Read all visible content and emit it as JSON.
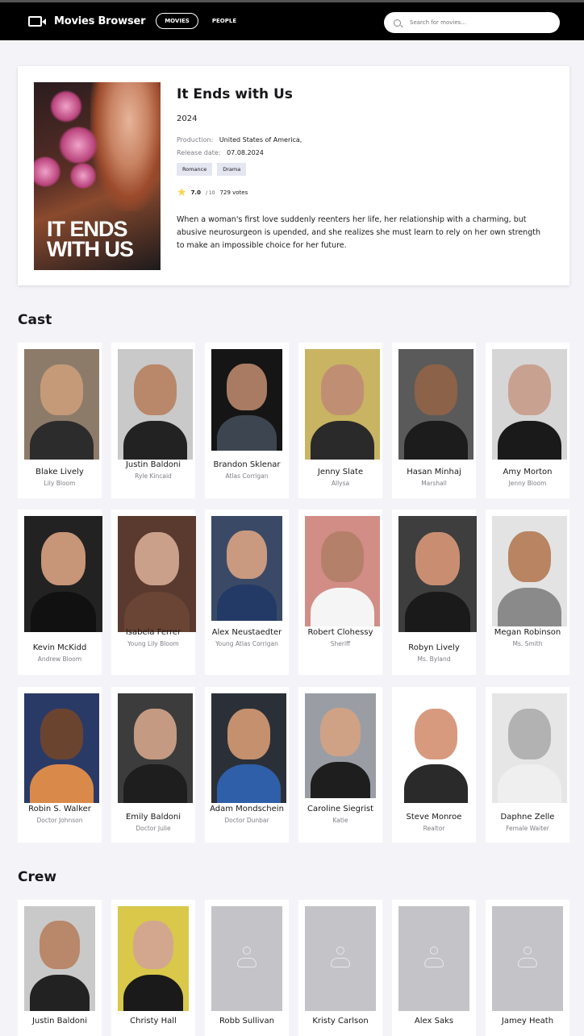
{
  "app": {
    "title": "Movies Browser"
  },
  "nav": {
    "movies_label": "MOVIES",
    "people_label": "PEOPLE"
  },
  "search": {
    "placeholder": "Search for movies..."
  },
  "movie": {
    "poster_text_line1": "IT ENDS",
    "poster_text_line2": "WITH US",
    "title": "It Ends with Us",
    "year": "2024",
    "production_label": "Production:",
    "production": "United States of America,",
    "release_label": "Release date:",
    "release_date": "07.08.2024",
    "genres": [
      "Romance",
      "Drama"
    ],
    "rating": "7.0",
    "rating_max": "/ 10",
    "votes": "729 votes",
    "description": "When a woman's first love suddenly reenters her life, her relationship with a charming, but abusive neurosurgeon is upended, and she realizes she must learn to rely on her own strength to make an impossible choice for her future."
  },
  "cast_title": "Cast",
  "cast": [
    {
      "name": "Blake Lively",
      "role": "Lily Bloom",
      "colors": [
        "#8d7b6a",
        "#c49a78",
        "#2c2c2c"
      ]
    },
    {
      "name": "Justin Baldoni",
      "role": "Ryle Kincaid",
      "colors": [
        "#c9c9c9",
        "#b9876a",
        "#222"
      ]
    },
    {
      "name": "Brandon Sklenar",
      "role": "Atlas Corrigan",
      "colors": [
        "#151515",
        "#a87b62",
        "#3d4650"
      ]
    },
    {
      "name": "Jenny Slate",
      "role": "Allysa",
      "colors": [
        "#c8b462",
        "#c08f73",
        "#2a2a2a"
      ]
    },
    {
      "name": "Hasan Minhaj",
      "role": "Marshall",
      "colors": [
        "#5a5a5a",
        "#8c6248",
        "#1c1c1c"
      ]
    },
    {
      "name": "Amy Morton",
      "role": "Jenny Bloom",
      "colors": [
        "#d6d6d6",
        "#c9a190",
        "#1a1a1a"
      ]
    },
    {
      "name": "Kevin McKidd",
      "role": "Andrew Bloom",
      "colors": [
        "#222",
        "#c79577",
        "#111"
      ]
    },
    {
      "name": "Isabela Ferrer",
      "role": "Young Lily Bloom",
      "colors": [
        "#5a3a2e",
        "#caa08a",
        "#6a4434"
      ]
    },
    {
      "name": "Alex Neustaedter",
      "role": "Young Atlas Corrigan",
      "colors": [
        "#3a4a66",
        "#c99a80",
        "#243a66"
      ]
    },
    {
      "name": "Robert Clohessy",
      "role": "Sheriff",
      "colors": [
        "#d28d86",
        "#b5806a",
        "#f5f5f5"
      ]
    },
    {
      "name": "Robyn Lively",
      "role": "Ms. Byland",
      "colors": [
        "#3e3e3e",
        "#c98e72",
        "#1a1a1a"
      ]
    },
    {
      "name": "Megan Robinson",
      "role": "Ms. Smith",
      "colors": [
        "#e3e3e3",
        "#b88462",
        "#8a8a8a"
      ]
    },
    {
      "name": "Robin S. Walker",
      "role": "Doctor Johnson",
      "colors": [
        "#2a3a66",
        "#6b4430",
        "#d98a4a"
      ]
    },
    {
      "name": "Emily Baldoni",
      "role": "Doctor Julie",
      "colors": [
        "#3c3c3c",
        "#c49a82",
        "#1e1e1e"
      ]
    },
    {
      "name": "Adam Mondschein",
      "role": "Doctor Dunbar",
      "colors": [
        "#2b3038",
        "#c4906e",
        "#2e5fa8"
      ]
    },
    {
      "name": "Caroline Siegrist",
      "role": "Katie",
      "colors": [
        "#9a9ea4",
        "#cfa286",
        "#1e1e1e"
      ]
    },
    {
      "name": "Steve Monroe",
      "role": "Realtor",
      "colors": [
        "#ffffff",
        "#d79a7f",
        "#2a2a2a"
      ]
    },
    {
      "name": "Daphne Zelle",
      "role": "Female Waiter",
      "colors": [
        "#e6e6e6",
        "#b2b2b2",
        "#efefef"
      ]
    }
  ],
  "crew_title": "Crew",
  "crew": [
    {
      "name": "Justin Baldoni",
      "colors": [
        "#c9c9c9",
        "#b9876a",
        "#222"
      ],
      "placeholder": false
    },
    {
      "name": "Christy Hall",
      "colors": [
        "#d9c84a",
        "#d3a78e",
        "#1a1a1a"
      ],
      "placeholder": false
    },
    {
      "name": "Robb Sullivan",
      "placeholder": true
    },
    {
      "name": "Kristy Carlson",
      "placeholder": true
    },
    {
      "name": "Alex Saks",
      "placeholder": true
    },
    {
      "name": "Jamey Heath",
      "placeholder": true
    }
  ]
}
